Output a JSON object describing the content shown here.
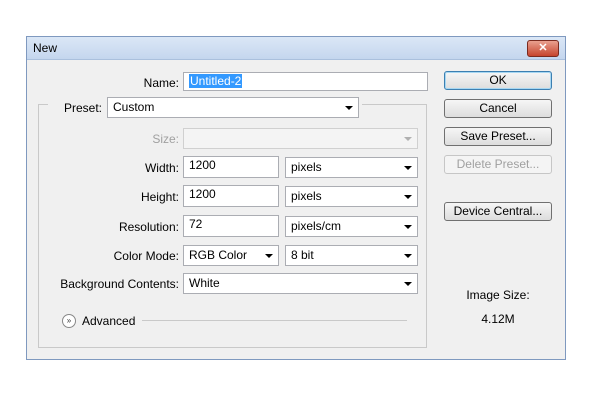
{
  "window": {
    "title": "New",
    "close_glyph": "✕"
  },
  "name": {
    "label": "Name:",
    "value": "Untitled-2"
  },
  "preset": {
    "label": "Preset:",
    "value": "Custom"
  },
  "size": {
    "label": "Size:",
    "value": ""
  },
  "width": {
    "label": "Width:",
    "value": "1200",
    "unit": "pixels"
  },
  "height": {
    "label": "Height:",
    "value": "1200",
    "unit": "pixels"
  },
  "resolution": {
    "label": "Resolution:",
    "value": "72",
    "unit": "pixels/cm"
  },
  "color_mode": {
    "label": "Color Mode:",
    "value": "RGB Color",
    "bit": "8 bit"
  },
  "background": {
    "label": "Background Contents:",
    "value": "White"
  },
  "advanced": {
    "label": "Advanced",
    "icon": "chevron-double-down-icon"
  },
  "buttons": {
    "ok": "OK",
    "cancel": "Cancel",
    "save_preset": "Save Preset...",
    "delete_preset": "Delete Preset...",
    "device_central": "Device Central..."
  },
  "image_size": {
    "label": "Image Size:",
    "value": "4.12M"
  },
  "colors": {
    "title_bar": "#c4d6ee",
    "selection": "#3399ff",
    "dialog_bg": "#f0f0f0"
  }
}
